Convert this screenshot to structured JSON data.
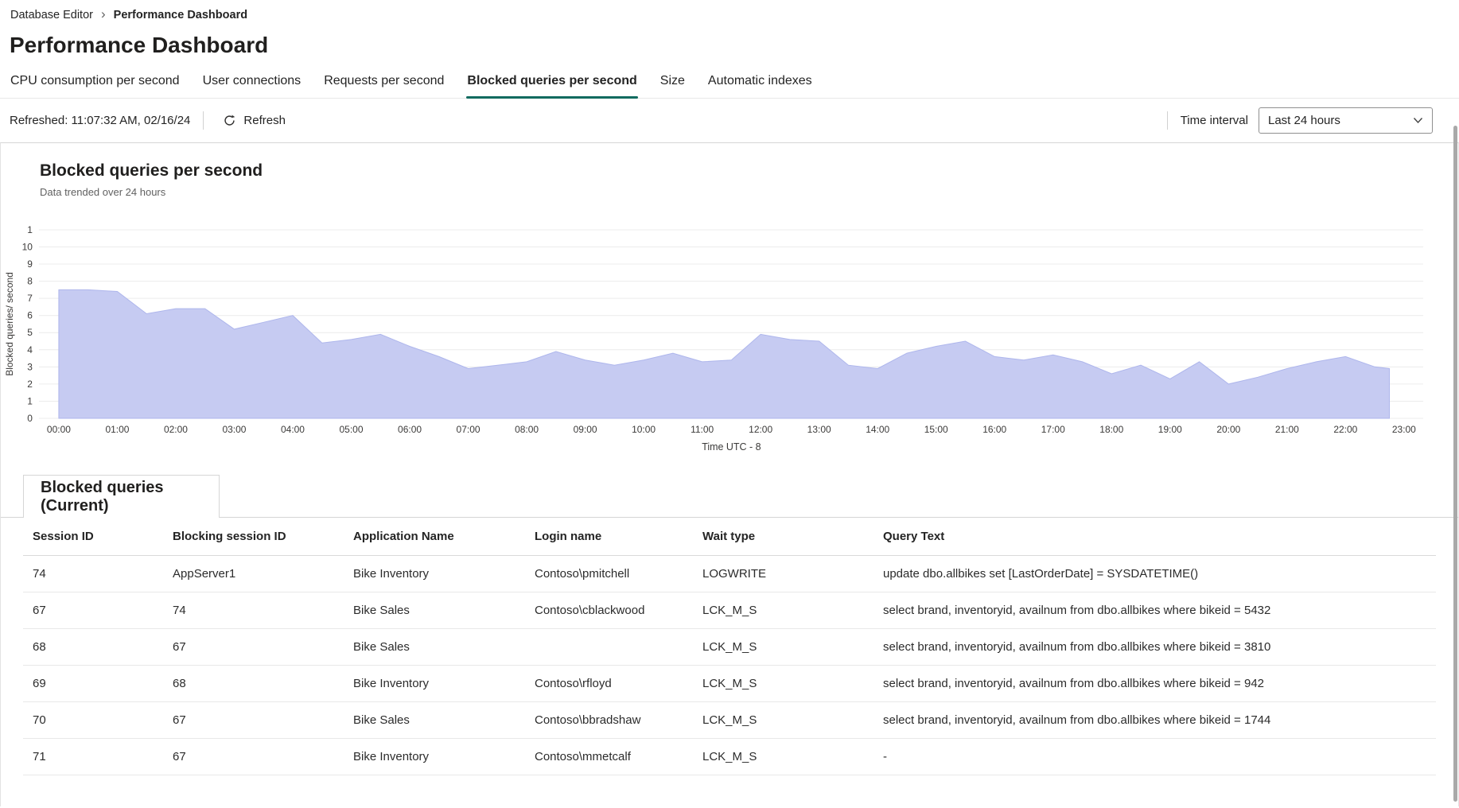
{
  "breadcrumb": {
    "items": [
      "Database Editor",
      "Performance Dashboard"
    ],
    "separator": "›"
  },
  "page": {
    "title": "Performance Dashboard"
  },
  "tabs": [
    {
      "label": "CPU consumption per second",
      "active": false
    },
    {
      "label": "User connections",
      "active": false
    },
    {
      "label": "Requests per second",
      "active": false
    },
    {
      "label": "Blocked queries per second",
      "active": true
    },
    {
      "label": "Size",
      "active": false
    },
    {
      "label": "Automatic indexes",
      "active": false
    }
  ],
  "toolbar": {
    "refreshed_label": "Refreshed: 11:07:32 AM, 02/16/24",
    "refresh_label": "Refresh",
    "time_interval_label": "Time interval",
    "time_interval_value": "Last 24 hours"
  },
  "icons": {
    "breadcrumb_separator": "chevron-right",
    "refresh": "circular-arrow",
    "time_interval_dropdown": "chevron-down"
  },
  "colors": {
    "active_tab_accent": "#0f6b5f",
    "chart_fill": "#c6cbf2",
    "chart_stroke": "#aeb6ec"
  },
  "chart_section": {
    "title": "Blocked queries per second",
    "subtitle": "Data trended over 24 hours"
  },
  "chart_data": {
    "type": "area",
    "title": "Blocked queries per second",
    "xlabel": "Time UTC - 8",
    "ylabel": "Blocked queries/ second",
    "ylim": [
      0,
      11
    ],
    "grid": "horizontal",
    "legend": "none",
    "fill_color": "#c6cbf2",
    "stroke_color": "#aeb6ec",
    "x_tick_labels": [
      "00:00",
      "01:00",
      "02:00",
      "03:00",
      "04:00",
      "05:00",
      "06:00",
      "07:00",
      "08:00",
      "09:00",
      "10:00",
      "11:00",
      "12:00",
      "13:00",
      "14:00",
      "15:00",
      "16:00",
      "17:00",
      "18:00",
      "19:00",
      "20:00",
      "21:00",
      "22:00",
      "23:00"
    ],
    "yticks": [
      {
        "value": 11,
        "label": "1"
      },
      {
        "value": 10,
        "label": "10"
      },
      {
        "value": 9,
        "label": "9"
      },
      {
        "value": 8,
        "label": "8"
      },
      {
        "value": 7,
        "label": "7"
      },
      {
        "value": 6,
        "label": "6"
      },
      {
        "value": 5,
        "label": "5"
      },
      {
        "value": 4,
        "label": "4"
      },
      {
        "value": 3,
        "label": "3"
      },
      {
        "value": 2,
        "label": "2"
      },
      {
        "value": 1,
        "label": "1"
      },
      {
        "value": 0,
        "label": "0"
      }
    ],
    "x": [
      0,
      0.5,
      1,
      1.5,
      2,
      2.5,
      3,
      3.5,
      4,
      4.5,
      5,
      5.5,
      6,
      6.5,
      7,
      7.5,
      8,
      8.5,
      9,
      9.5,
      10,
      10.5,
      11,
      11.5,
      12,
      12.5,
      13,
      13.5,
      14,
      14.5,
      15,
      15.5,
      16,
      16.5,
      17,
      17.5,
      18,
      18.5,
      19,
      19.5,
      20,
      20.5,
      21,
      21.5,
      22,
      22.5,
      22.75
    ],
    "values": [
      7.5,
      7.5,
      7.4,
      6.1,
      6.4,
      6.4,
      5.2,
      5.6,
      6.0,
      4.4,
      4.6,
      4.9,
      4.2,
      3.6,
      2.9,
      3.1,
      3.3,
      3.9,
      3.4,
      3.1,
      3.4,
      3.8,
      3.3,
      3.4,
      4.9,
      4.6,
      4.5,
      3.1,
      2.9,
      3.8,
      4.2,
      4.5,
      3.6,
      3.4,
      3.7,
      3.3,
      2.6,
      3.1,
      2.3,
      3.3,
      2.0,
      2.4,
      2.9,
      3.3,
      3.6,
      3.0,
      2.9
    ]
  },
  "table_section": {
    "title": "Blocked queries (Current)"
  },
  "table": {
    "columns": [
      "Session ID",
      "Blocking session ID",
      "Application Name",
      "Login name",
      "Wait type",
      "Query Text"
    ],
    "rows": [
      [
        "74",
        "AppServer1",
        "Bike Inventory",
        "Contoso\\pmitchell",
        "LOGWRITE",
        "update  dbo.allbikes  set [LastOrderDate] = SYSDATETIME()"
      ],
      [
        "67",
        "74",
        "Bike Sales",
        "Contoso\\cblackwood",
        "LCK_M_S",
        "select brand, inventoryid, availnum  from dbo.allbikes where bikeid = 5432"
      ],
      [
        "68",
        "67",
        "Bike Sales",
        "",
        "LCK_M_S",
        "select brand, inventoryid, availnum  from dbo.allbikes where bikeid = 3810"
      ],
      [
        "69",
        "68",
        "Bike Inventory",
        "Contoso\\rfloyd",
        "LCK_M_S",
        "select brand, inventoryid, availnum  from dbo.allbikes where bikeid = 942"
      ],
      [
        "70",
        "67",
        "Bike Sales",
        "Contoso\\bbradshaw",
        "LCK_M_S",
        "select brand, inventoryid, availnum  from dbo.allbikes where bikeid = 1744"
      ],
      [
        "71",
        "67",
        "Bike Inventory",
        "Contoso\\mmetcalf",
        "LCK_M_S",
        "-"
      ]
    ]
  }
}
